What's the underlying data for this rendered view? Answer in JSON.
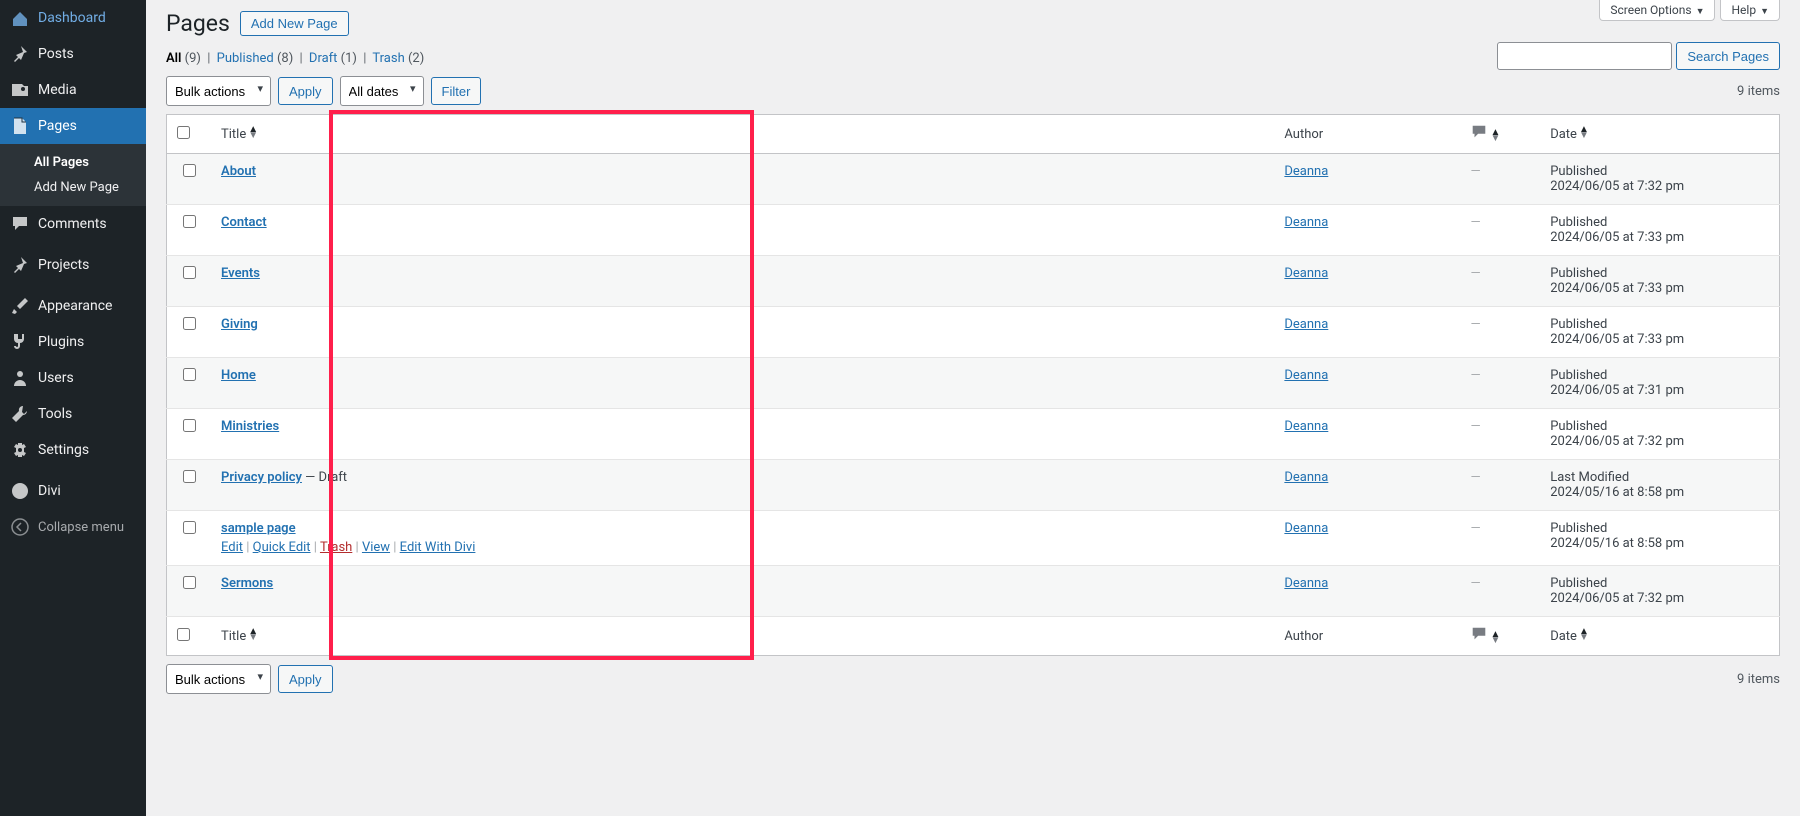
{
  "sidebar": {
    "items": [
      {
        "label": "Dashboard",
        "icon": "dashboard"
      },
      {
        "label": "Posts",
        "icon": "pin"
      },
      {
        "label": "Media",
        "icon": "media"
      },
      {
        "label": "Pages",
        "icon": "page",
        "current": true
      },
      {
        "label": "Comments",
        "icon": "comment"
      },
      {
        "label": "Projects",
        "icon": "pin"
      },
      {
        "label": "Appearance",
        "icon": "brush"
      },
      {
        "label": "Plugins",
        "icon": "plug"
      },
      {
        "label": "Users",
        "icon": "user"
      },
      {
        "label": "Tools",
        "icon": "tools"
      },
      {
        "label": "Settings",
        "icon": "settings"
      },
      {
        "label": "Divi",
        "icon": "divi"
      }
    ],
    "submenu": [
      {
        "label": "All Pages",
        "current": true
      },
      {
        "label": "Add New Page"
      }
    ],
    "collapse": "Collapse menu"
  },
  "screen_tabs": {
    "options": "Screen Options",
    "help": "Help"
  },
  "header": {
    "title": "Pages",
    "add_new": "Add New Page"
  },
  "filters": {
    "all": {
      "label": "All",
      "count": "(9)"
    },
    "published": {
      "label": "Published",
      "count": "(8)"
    },
    "draft": {
      "label": "Draft",
      "count": "(1)"
    },
    "trash": {
      "label": "Trash",
      "count": "(2)"
    }
  },
  "search": {
    "button": "Search Pages",
    "value": ""
  },
  "bulk": {
    "actions": "Bulk actions",
    "apply": "Apply",
    "dates": "All dates",
    "filter": "Filter"
  },
  "pagination": {
    "items": "9 items"
  },
  "columns": {
    "title": "Title",
    "author": "Author",
    "date": "Date"
  },
  "rows": [
    {
      "title": "About",
      "author": "Deanna",
      "status": "Published",
      "date": "2024/06/05 at 7:32 pm",
      "comments": "—"
    },
    {
      "title": "Contact",
      "author": "Deanna",
      "status": "Published",
      "date": "2024/06/05 at 7:33 pm",
      "comments": "—"
    },
    {
      "title": "Events",
      "author": "Deanna",
      "status": "Published",
      "date": "2024/06/05 at 7:33 pm",
      "comments": "—"
    },
    {
      "title": "Giving",
      "author": "Deanna",
      "status": "Published",
      "date": "2024/06/05 at 7:33 pm",
      "comments": "—"
    },
    {
      "title": "Home",
      "author": "Deanna",
      "status": "Published",
      "date": "2024/06/05 at 7:31 pm",
      "comments": "—"
    },
    {
      "title": "Ministries",
      "author": "Deanna",
      "status": "Published",
      "date": "2024/06/05 at 7:32 pm",
      "comments": "—"
    },
    {
      "title": "Privacy policy",
      "suffix": " — Draft",
      "author": "Deanna",
      "status": "Last Modified",
      "date": "2024/05/16 at 8:58 pm",
      "comments": "—"
    },
    {
      "title": "sample page",
      "author": "Deanna",
      "status": "Published",
      "date": "2024/05/16 at 8:58 pm",
      "comments": "—",
      "actions": true
    },
    {
      "title": "Sermons",
      "author": "Deanna",
      "status": "Published",
      "date": "2024/06/05 at 7:32 pm",
      "comments": "—"
    }
  ],
  "row_actions": {
    "edit": "Edit",
    "quick": "Quick Edit",
    "trash": "Trash",
    "view": "View",
    "divi": "Edit With Divi"
  }
}
